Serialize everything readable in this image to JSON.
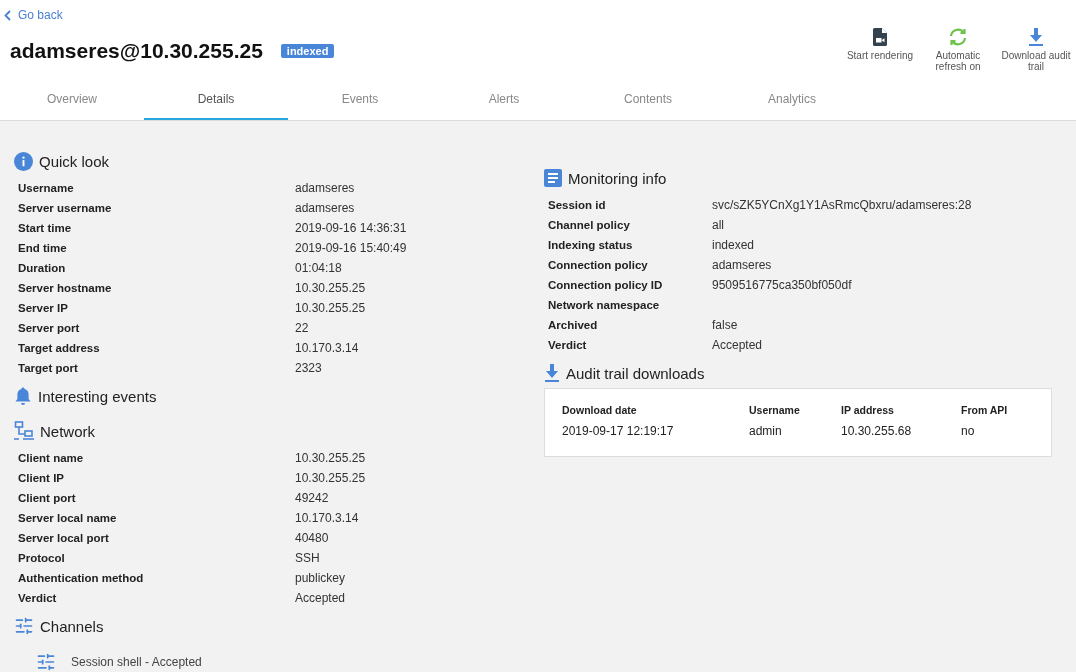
{
  "back_link": {
    "label": "Go back"
  },
  "title": "adamseres@10.30.255.25",
  "badge": "indexed",
  "toolbar": [
    {
      "kind": "render",
      "label": "Start rendering"
    },
    {
      "kind": "refresh",
      "label": "Automatic refresh on"
    },
    {
      "kind": "download",
      "label": "Download audit trail"
    }
  ],
  "tabs": [
    {
      "label": "Overview",
      "selected": false
    },
    {
      "label": "Details",
      "selected": true
    },
    {
      "label": "Events",
      "selected": false
    },
    {
      "label": "Alerts",
      "selected": false
    },
    {
      "label": "Contents",
      "selected": false
    },
    {
      "label": "Analytics",
      "selected": false
    }
  ],
  "left_sections": [
    {
      "kind": "info",
      "title": "Quick look",
      "rows": [
        {
          "label": "Username",
          "value": "adamseres"
        },
        {
          "label": "Server username",
          "value": "adamseres"
        },
        {
          "label": "Start time",
          "value": "2019-09-16 14:36:31"
        },
        {
          "label": "End time",
          "value": "2019-09-16 15:40:49"
        },
        {
          "label": "Duration",
          "value": "01:04:18"
        },
        {
          "label": "Server hostname",
          "value": "10.30.255.25"
        },
        {
          "label": "Server IP",
          "value": "10.30.255.25"
        },
        {
          "label": "Server port",
          "value": "22"
        },
        {
          "label": "Target address",
          "value": "10.170.3.14"
        },
        {
          "label": "Target port",
          "value": "2323"
        }
      ]
    },
    {
      "kind": "events",
      "title": "Interesting events"
    },
    {
      "kind": "network",
      "title": "Network",
      "rows": [
        {
          "label": "Client name",
          "value": "10.30.255.25"
        },
        {
          "label": "Client IP",
          "value": "10.30.255.25"
        },
        {
          "label": "Client port",
          "value": "49242"
        },
        {
          "label": "Server local name",
          "value": "10.170.3.14"
        },
        {
          "label": "Server local port",
          "value": "40480"
        },
        {
          "label": "Protocol",
          "value": "SSH"
        },
        {
          "label": "Authentication method",
          "value": "publickey"
        },
        {
          "label": "Verdict",
          "value": "Accepted"
        }
      ]
    },
    {
      "kind": "channels",
      "title": "Channels",
      "channels": [
        "Session shell - Accepted"
      ]
    }
  ],
  "right_sections": [
    {
      "kind": "monitoring",
      "title": "Monitoring info",
      "rows": [
        {
          "label": "Session id",
          "value": "svc/sZK5YCnXg1Y1AsRmcQbxru/adamseres:28"
        },
        {
          "label": "Channel policy",
          "value": "all"
        },
        {
          "label": "Indexing status",
          "value": "indexed"
        },
        {
          "label": "Connection policy",
          "value": "adamseres"
        },
        {
          "label": "Connection policy ID",
          "value": "9509516775ca350bf050df"
        },
        {
          "label": "Network namespace"
        },
        {
          "label": "Archived",
          "value": "false"
        },
        {
          "label": "Verdict",
          "value": "Accepted"
        }
      ]
    },
    {
      "kind": "downloads",
      "title": "Audit trail downloads",
      "table": {
        "columns": [
          "Download date",
          "Username",
          "IP address",
          "From API"
        ],
        "rows": [
          [
            "2019-09-17 12:19:17",
            "admin",
            "10.30.255.68",
            "no"
          ]
        ]
      }
    }
  ]
}
